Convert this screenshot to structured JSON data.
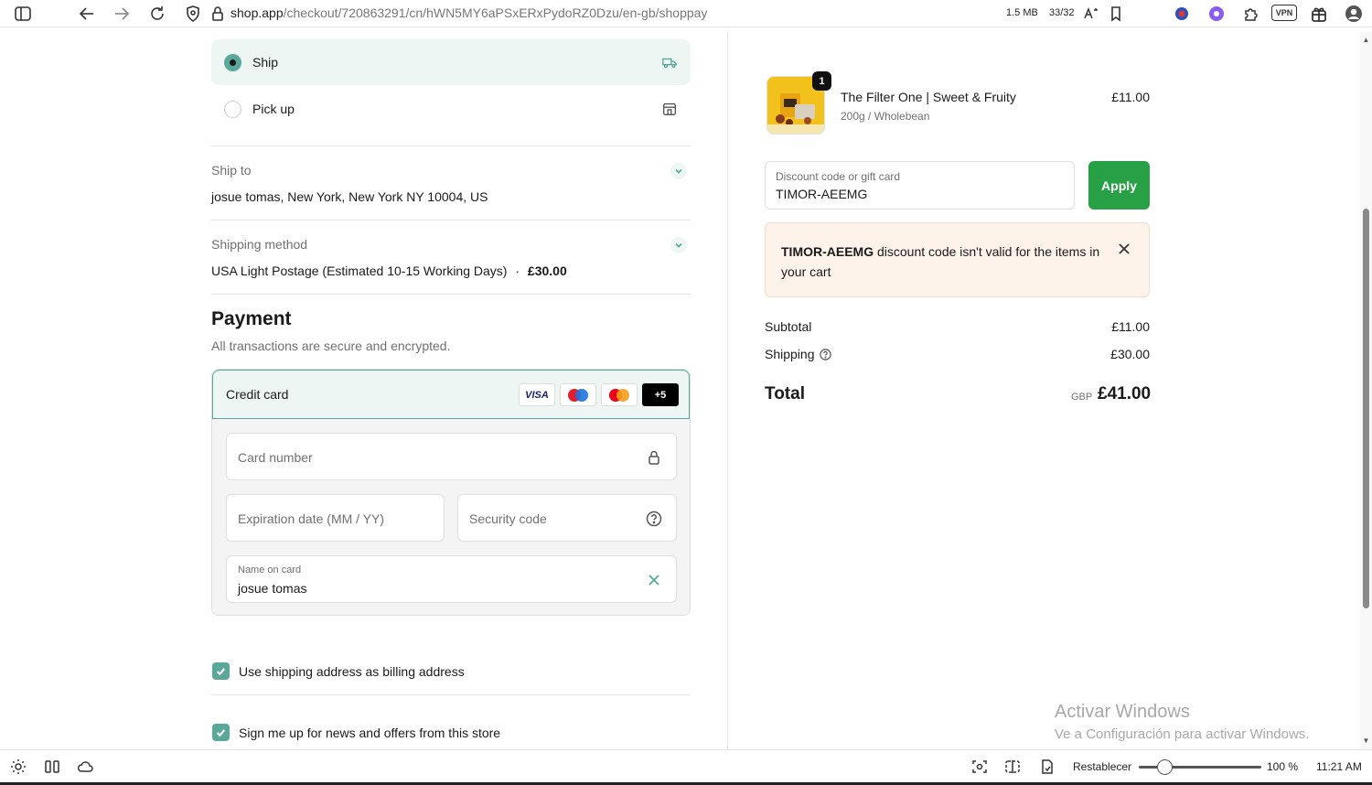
{
  "browser": {
    "url_host": "shop.app",
    "url_path": "/checkout/720863291/cn/hWN5MY6aPSxERxPydoRZ0Dzu/en-gb/shoppay",
    "memory": "1.5 MB",
    "tab_count": "33/32",
    "vpn_label": "VPN"
  },
  "delivery": {
    "ship_label": "Ship",
    "pickup_label": "Pick up",
    "ship_to_label": "Ship to",
    "ship_to_value": "josue tomas, New York, New York NY 10004, US",
    "shipping_method_label": "Shipping method",
    "shipping_method_value": "USA Light Postage (Estimated 10-15 Working Days)",
    "shipping_method_sep": "·",
    "shipping_method_price": "£30.00"
  },
  "payment": {
    "title": "Payment",
    "subtitle": "All transactions are secure and encrypted.",
    "method_label": "Credit card",
    "card_logos": [
      "VISA",
      "+5"
    ],
    "card_number_placeholder": "Card number",
    "expiry_placeholder": "Expiration date (MM / YY)",
    "security_placeholder": "Security code",
    "name_label": "Name on card",
    "name_value": "josue tomas",
    "billing_checkbox_label": "Use shipping address as billing address",
    "newsletter_checkbox_label": "Sign me up for news and offers from this store"
  },
  "order": {
    "quantity": "1",
    "product_name": "The Filter One | Sweet & Fruity",
    "product_variant": "200g / Wholebean",
    "product_price": "£11.00",
    "discount_label": "Discount code or gift card",
    "discount_value": "TIMOR-AEEMG",
    "apply_label": "Apply",
    "alert_code": "TIMOR-AEEMG",
    "alert_message": " discount code isn't valid for the items in your cart",
    "subtotal_label": "Subtotal",
    "subtotal_value": "£11.00",
    "shipping_label": "Shipping",
    "shipping_value": "£30.00",
    "total_label": "Total",
    "total_currency": "GBP",
    "total_value": "£41.00"
  },
  "watermark": {
    "line1": "Activar Windows",
    "line2": "Ve a Configuración para activar Windows."
  },
  "statusbar": {
    "reset_label": "Restablecer",
    "zoom": "100 %",
    "time": "11:21 AM",
    "zoom_level": 0.13
  },
  "colors": {
    "accent": "#5aa89a",
    "apply_green": "#27a046",
    "alert_bg": "#fdf3ea"
  }
}
